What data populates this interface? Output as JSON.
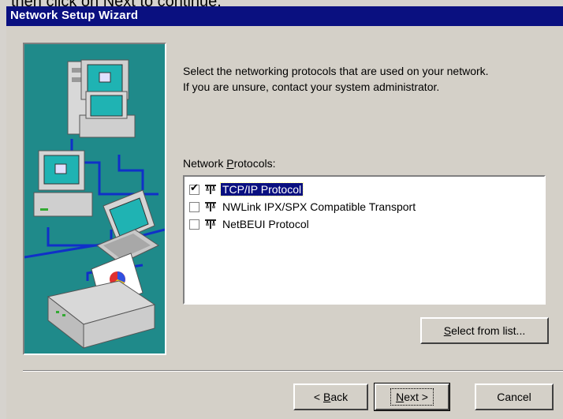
{
  "background_caption": "then click on Next  to continue.",
  "window": {
    "title": "Network Setup Wizard"
  },
  "instructions": {
    "line1": "Select the networking protocols that are used on your network.",
    "line2": "If you are unsure, contact your system administrator."
  },
  "protocols": {
    "label_prefix": "Network ",
    "label_accel": "P",
    "label_rest": "rotocols:",
    "items": [
      {
        "label": "TCP/IP Protocol",
        "checked": true,
        "selected": true,
        "check_mark": "✔"
      },
      {
        "label": "NWLink IPX/SPX Compatible Transport",
        "checked": false,
        "selected": false,
        "check_mark": ""
      },
      {
        "label": "NetBEUI Protocol",
        "checked": false,
        "selected": false,
        "check_mark": ""
      }
    ]
  },
  "buttons": {
    "select_from_list": {
      "accel": "S",
      "rest": "elect from list..."
    },
    "back": {
      "prefix": "< ",
      "accel": "B",
      "rest": "ack"
    },
    "next": {
      "accel": "N",
      "rest": "ext >"
    },
    "cancel": {
      "label": "Cancel"
    }
  },
  "colors": {
    "titlebar": "#0a1080",
    "illustration_bg": "#1f8a8a",
    "selection": "#0a1080"
  }
}
